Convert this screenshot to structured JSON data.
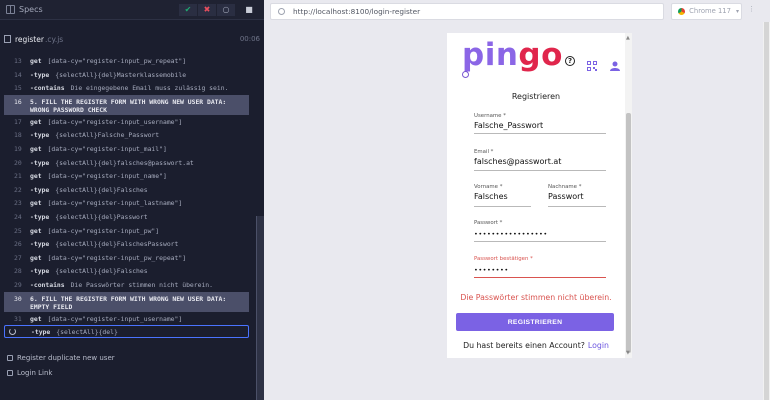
{
  "specs_bar": {
    "label": "Specs"
  },
  "status": {
    "passed": "✔",
    "failed": "✖",
    "pending": "○",
    "stop": "■"
  },
  "suite": {
    "name": "register",
    "ext": ".cy.js",
    "time": "00:06"
  },
  "commands": [
    {
      "ln": "13",
      "cmd": "get",
      "arg": "[data-cy=\"register-input_pw_repeat\"]"
    },
    {
      "ln": "14",
      "cmd": "-type",
      "arg": "{selectAll}{del}Masterklassemobile"
    },
    {
      "ln": "15",
      "cmd": "-contains",
      "arg": "Die eingegebene Email muss zulässig sein."
    },
    {
      "ln": "16",
      "cmd": "5. FILL THE REGISTER FORM WITH WRONG NEW USER DATA: WRONG PASSWORD CHECK",
      "arg": ""
    },
    {
      "ln": "17",
      "cmd": "get",
      "arg": "[data-cy=\"register-input_username\"]"
    },
    {
      "ln": "18",
      "cmd": "-type",
      "arg": "{selectAll}Falsche_Passwort"
    },
    {
      "ln": "19",
      "cmd": "get",
      "arg": "[data-cy=\"register-input_mail\"]"
    },
    {
      "ln": "20",
      "cmd": "-type",
      "arg": "{selectAll}{del}falsches@passwort.at"
    },
    {
      "ln": "21",
      "cmd": "get",
      "arg": "[data-cy=\"register-input_name\"]"
    },
    {
      "ln": "22",
      "cmd": "-type",
      "arg": "{selectAll}{del}Falsches"
    },
    {
      "ln": "23",
      "cmd": "get",
      "arg": "[data-cy=\"register-input_lastname\"]"
    },
    {
      "ln": "24",
      "cmd": "-type",
      "arg": "{selectAll}{del}Passwort"
    },
    {
      "ln": "25",
      "cmd": "get",
      "arg": "[data-cy=\"register-input_pw\"]"
    },
    {
      "ln": "26",
      "cmd": "-type",
      "arg": "{selectAll}{del}FalschesPasswort"
    },
    {
      "ln": "27",
      "cmd": "get",
      "arg": "[data-cy=\"register-input_pw_repeat\"]"
    },
    {
      "ln": "28",
      "cmd": "-type",
      "arg": "{selectAll}{del}Falsches"
    },
    {
      "ln": "29",
      "cmd": "-contains",
      "arg": "Die Passwörter stimmen nicht überein."
    },
    {
      "ln": "30",
      "cmd": "6. FILL THE REGISTER FORM WITH WRONG NEW USER DATA: EMPTY FIELD",
      "arg": ""
    },
    {
      "ln": "31",
      "cmd": "get",
      "arg": "[data-cy=\"register-input_username\"]"
    },
    {
      "ln": "",
      "cmd": "-type",
      "arg": "{selectAll}{del}"
    }
  ],
  "tests": {
    "duplicate": "Register duplicate new user",
    "login_link": "Login Link"
  },
  "browser": {
    "url": "http://localhost:8100/login-register",
    "name": "Chrome 117",
    "caret": "▾"
  },
  "app": {
    "logo_pin": "pin",
    "logo_go": "go",
    "help_icon": "?",
    "form_title": "Registrieren",
    "username": {
      "label": "Username *",
      "value": "Falsche_Passwort"
    },
    "email": {
      "label": "Email *",
      "value": "falsches@passwort.at"
    },
    "firstname": {
      "label": "Vorname *",
      "value": "Falsches"
    },
    "lastname": {
      "label": "Nachname *",
      "value": "Passwort"
    },
    "password": {
      "label": "Passwort *",
      "value": "•••••••••••••••••"
    },
    "password_repeat": {
      "label": "Passwort bestätigen *",
      "value": "••••••••"
    },
    "error": "Die Passwörter stimmen nicht überein.",
    "register_button": "REGISTRIEREN",
    "login_prompt": "Du hast bereits einen Account?",
    "login_link": "Login"
  },
  "colors": {
    "accent": "#7b62e4",
    "logo_purple": "#8b66e6",
    "logo_red": "#e0264c",
    "error": "#d9534f"
  }
}
